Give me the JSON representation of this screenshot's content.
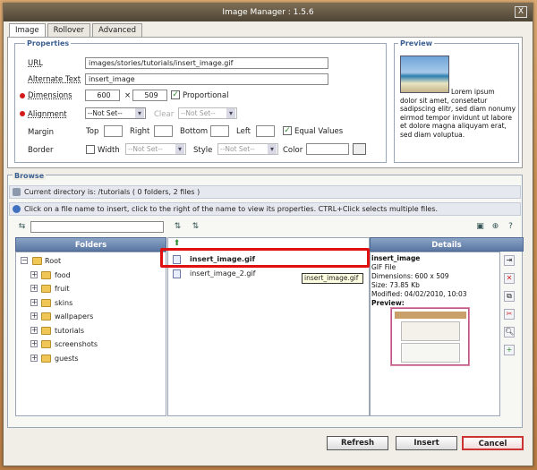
{
  "window": {
    "title": "Image Manager : 1.5.6",
    "close_label": "X"
  },
  "tabs": [
    "Image",
    "Rollover",
    "Advanced"
  ],
  "properties": {
    "legend": "Properties",
    "url_label": "URL",
    "url_value": "images/stories/tutorials/insert_image.gif",
    "alt_label": "Alternate Text",
    "alt_value": "insert_image",
    "dimensions_label": "Dimensions",
    "width_value": "600",
    "times": "×",
    "height_value": "509",
    "proportional_label": "Proportional",
    "alignment_label": "Alignment",
    "alignment_value": "--Not Set--",
    "clear_label": "Clear",
    "clear_value": "--Not Set--",
    "margin_label": "Margin",
    "top_label": "Top",
    "right_label": "Right",
    "bottom_label": "Bottom",
    "left_label": "Left",
    "equal_values_label": "Equal Values",
    "border_label": "Border",
    "width_label": "Width",
    "border_width_value": "--Not Set--",
    "style_label": "Style",
    "style_value": "--Not Set--",
    "color_label": "Color"
  },
  "preview": {
    "legend": "Preview",
    "lorem_first": "Lorem ipsum",
    "lorem_rest": "dolor sit amet, consetetur sadipscing elitr, sed diam nonumy eirmod tempor invidunt ut labore et dolore magna aliquyam erat, sed diam voluptua."
  },
  "browse": {
    "legend": "Browse",
    "current_dir": "Current directory is: /tutorials ( 0 folders, 2 files )",
    "help": "Click on a file name to insert, click to the right of the name to view its properties. CTRL+Click selects multiple files.",
    "folders_header": "Folders",
    "details_header": "Details",
    "root_label": "Root",
    "folders": [
      "food",
      "fruit",
      "skins",
      "wallpapers",
      "tutorials",
      "screenshots",
      "guests"
    ],
    "files": [
      "insert_image.gif",
      "insert_image_2.gif"
    ],
    "tooltip": "insert_image.gif"
  },
  "details": {
    "name": "insert_image",
    "type": "GIF File",
    "dimensions": "Dimensions: 600 x 509",
    "size": "Size: 73.85 Kb",
    "modified": "Modified: 04/02/2010, 10:03",
    "preview_label": "Preview:"
  },
  "buttons": {
    "refresh": "Refresh",
    "insert": "Insert",
    "cancel": "Cancel"
  },
  "colors": {
    "accent": "#5b78a3",
    "highlight": "#e01010",
    "required": "#d31b1b"
  }
}
